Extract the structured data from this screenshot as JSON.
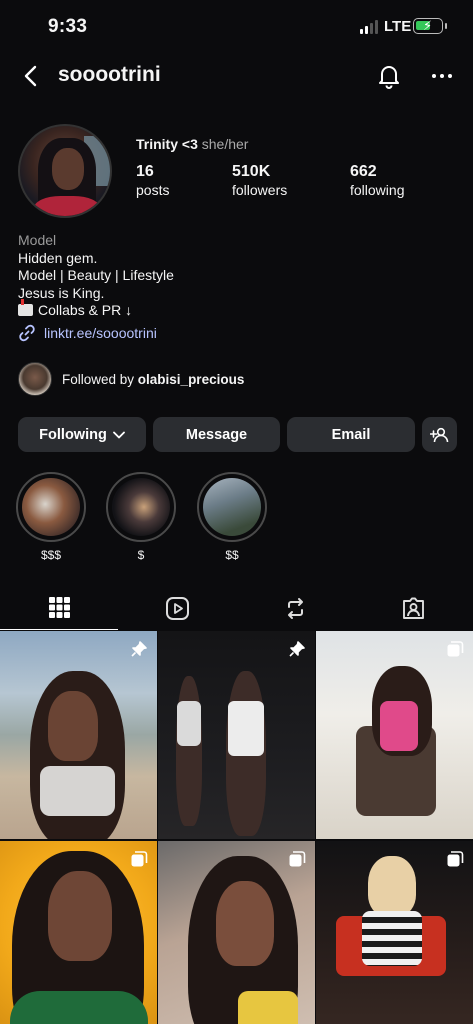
{
  "status_bar": {
    "time": "9:33",
    "network": "LTE"
  },
  "header": {
    "username": "sooootrini"
  },
  "profile": {
    "display_name": "Trinity <3",
    "pronouns": "she/her",
    "stats": [
      {
        "value": "16",
        "label": "posts"
      },
      {
        "value": "510K",
        "label": "followers"
      },
      {
        "value": "662",
        "label": "following"
      }
    ]
  },
  "bio": {
    "category": "Model",
    "lines": [
      "Hidden gem.",
      "Model | Beauty | Lifestyle",
      "Jesus is King.",
      "Collabs & PR ↓"
    ],
    "link": "linktr.ee/sooootrini"
  },
  "followed_by": {
    "prefix": "Followed by ",
    "user": "olabisi_precious"
  },
  "buttons": {
    "following": "Following",
    "message": "Message",
    "email": "Email"
  },
  "highlights": [
    {
      "label": "$$$"
    },
    {
      "label": "$"
    },
    {
      "label": "$$"
    }
  ],
  "tabs": [
    "grid-icon",
    "reels-icon",
    "reposts-icon",
    "tagged-icon"
  ],
  "posts": [
    {
      "badge": "pin-icon"
    },
    {
      "badge": "pin-icon"
    },
    {
      "badge": "carousel-icon"
    },
    {
      "badge": "carousel-icon"
    },
    {
      "badge": "carousel-icon"
    },
    {
      "badge": "carousel-icon"
    }
  ]
}
